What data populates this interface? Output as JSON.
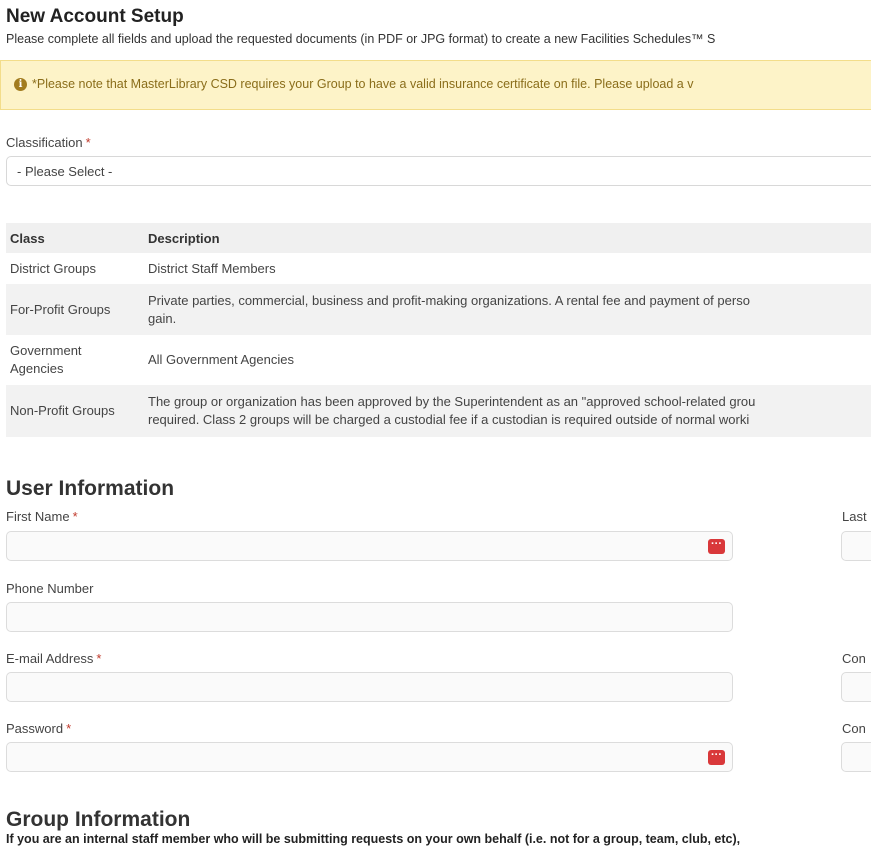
{
  "header": {
    "title": "New Account Setup",
    "subtitle": "Please complete all fields and upload the requested documents (in PDF or JPG format) to create a new Facilities Schedules™ S"
  },
  "notice": {
    "icon": "info-circle-icon",
    "text": "*Please note that MasterLibrary CSD requires your Group to have a valid insurance certificate on file. Please upload a v"
  },
  "classification": {
    "label": "Classification",
    "required_mark": "*",
    "selected": "- Please Select -"
  },
  "class_table": {
    "headers": [
      "Class",
      "Description"
    ],
    "rows": [
      {
        "class": "District Groups",
        "description": "District Staff Members"
      },
      {
        "class": "For-Profit Groups",
        "description": "Private parties, commercial, business and profit-making organizations. A rental fee and payment of perso",
        "description2": "gain."
      },
      {
        "class": "Government",
        "class2": "Agencies",
        "description": "All Government Agencies"
      },
      {
        "class": "Non-Profit Groups",
        "description": "The group or organization has been approved by the Superintendent as an \"approved school-related grou",
        "description2": "required. Class 2 groups will be charged a custodial fee if a custodian is required outside of normal worki"
      }
    ]
  },
  "user_info": {
    "heading": "User Information",
    "first_name_label": "First Name",
    "last_name_label": "Last",
    "phone_label": "Phone Number",
    "email_label": "E-mail Address",
    "confirm_email_label": "Con",
    "password_label": "Password",
    "confirm_password_label": "Con",
    "required_mark": "*",
    "password_manager_icon": "password-manager-icon"
  },
  "group_info": {
    "heading": "Group Information",
    "note": "If you are an internal staff member who will be submitting requests on your own behalf (i.e. not for a group, team, club, etc),"
  },
  "colors": {
    "notice_bg": "#fdf3c8",
    "notice_text": "#8a6d1a",
    "required": "#c0392b",
    "pm_icon": "#d9383a"
  }
}
